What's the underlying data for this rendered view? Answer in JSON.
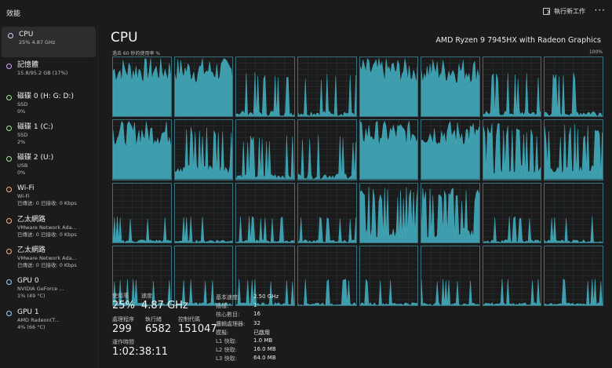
{
  "app": {
    "title": "效能",
    "run_task_label": "執行新工作",
    "more_label": "···"
  },
  "sidebar": {
    "items": [
      {
        "name": "CPU",
        "sub1": "25% 4.87 GHz",
        "sub2": "",
        "color": "#c9d3ff",
        "active": true
      },
      {
        "name": "記憶體",
        "sub1": "15.8/95.2 GB (17%)",
        "sub2": "",
        "color": "#d9a6ff"
      },
      {
        "name": "磁碟 0 (H: G: D:)",
        "sub1": "SSD",
        "sub2": "0%",
        "color": "#a6e39a"
      },
      {
        "name": "磁碟 1 (C:)",
        "sub1": "SSD",
        "sub2": "2%",
        "color": "#a6e39a"
      },
      {
        "name": "磁碟 2 (U:)",
        "sub1": "USB",
        "sub2": "0%",
        "color": "#a6e39a"
      },
      {
        "name": "Wi-Fi",
        "sub1": "Wi-Fi",
        "sub2": "已傳送: 0 已接收: 0 Kbps",
        "color": "#f0b48a"
      },
      {
        "name": "乙太網路",
        "sub1": "VMware Network Ada...",
        "sub2": "已傳送: 0 已接收: 0 Kbps",
        "color": "#f0b48a"
      },
      {
        "name": "乙太網路",
        "sub1": "VMware Network Ada...",
        "sub2": "已傳送: 0 已接收: 0 Kbps",
        "color": "#f0b48a"
      },
      {
        "name": "GPU 0",
        "sub1": "NVIDIA GeForce ...",
        "sub2": "1% (49 °C)",
        "color": "#9fd4ff"
      },
      {
        "name": "GPU 1",
        "sub1": "AMD Radeon(T...",
        "sub2": "4% (66 °C)",
        "color": "#9fd4ff"
      }
    ]
  },
  "main": {
    "heading": "CPU",
    "model": "AMD Ryzen 9 7945HX with Radeon Graphics",
    "graph_label": "過去 60 秒的使用率 %",
    "graph_max": "100%",
    "accent": "#44b4c6"
  },
  "stats": {
    "usage_label": "使用率",
    "usage_value": "25%",
    "speed_label": "速度",
    "speed_value": "4.87 GHz",
    "processes_label": "處理程序",
    "processes_value": "299",
    "threads_label": "執行緒",
    "threads_value": "6582",
    "handles_label": "控制代碼",
    "handles_value": "151047",
    "uptime_label": "運作時間",
    "uptime_value": "1:02:38:11"
  },
  "specs": [
    {
      "k": "基本速度:",
      "v": "2.50 GHz"
    },
    {
      "k": "插槽:",
      "v": "1"
    },
    {
      "k": "核心數目:",
      "v": "16"
    },
    {
      "k": "邏輯處理器:",
      "v": "32"
    },
    {
      "k": "模擬:",
      "v": "已啟用"
    },
    {
      "k": "L1 快取:",
      "v": "1.0 MB"
    },
    {
      "k": "L2 快取:",
      "v": "16.0 MB"
    },
    {
      "k": "L3 快取:",
      "v": "64.0 MB"
    }
  ],
  "core_loads": [
    "high",
    "high",
    "low",
    "low",
    "high",
    "high",
    "low",
    "low",
    "high",
    "mid",
    "low",
    "low",
    "high",
    "high",
    "mid",
    "mid",
    "vlow",
    "vlow",
    "vlow",
    "vlow",
    "mid",
    "mid",
    "vlow",
    "vlow",
    "vlow",
    "vlow",
    "vlow",
    "vlow",
    "vlow",
    "vlow",
    "vlow",
    "vlow"
  ]
}
